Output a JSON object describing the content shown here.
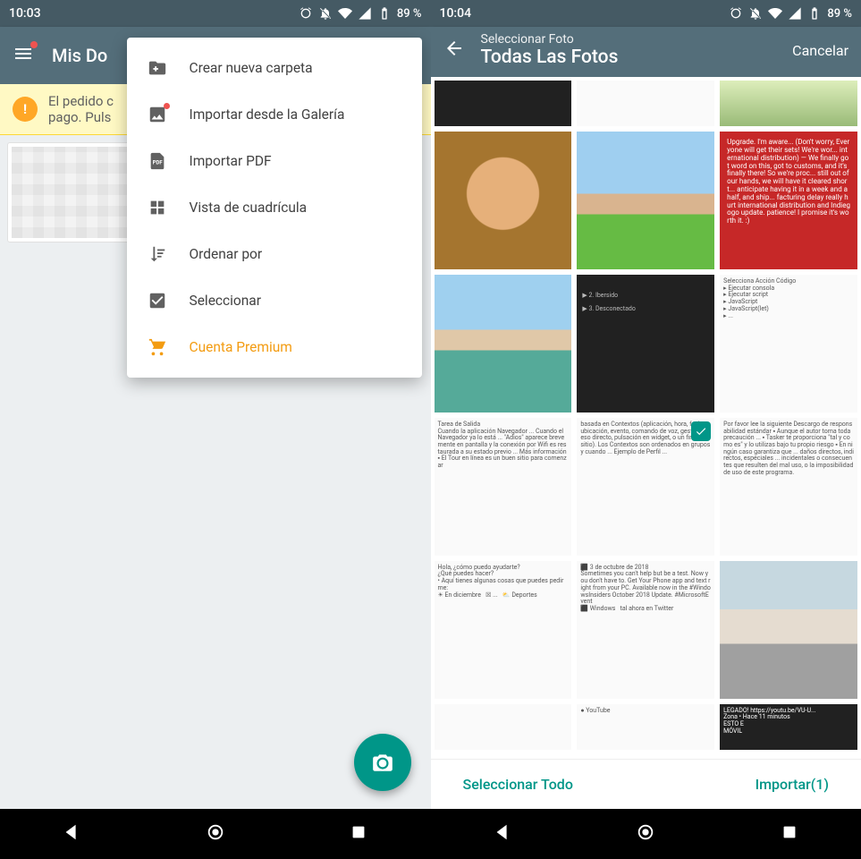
{
  "status": {
    "time_left": "10:03",
    "time_right": "10:04",
    "battery": "89 %"
  },
  "left": {
    "title": "Mis Do",
    "warning_line1": "El pedido c",
    "warning_line2": "pago. Puls",
    "menu": [
      {
        "icon": "folder-plus",
        "label": "Crear nueva carpeta",
        "dot": false
      },
      {
        "icon": "gallery",
        "label": "Importar desde la Galería",
        "dot": true
      },
      {
        "icon": "pdf",
        "label": "Importar PDF",
        "dot": false
      },
      {
        "icon": "grid",
        "label": "Vista de cuadrícula",
        "dot": false
      },
      {
        "icon": "sort",
        "label": "Ordenar por",
        "dot": false
      },
      {
        "icon": "check",
        "label": "Seleccionar",
        "dot": false
      },
      {
        "icon": "cart",
        "label": "Cuenta Premium",
        "dot": false,
        "premium": true
      }
    ]
  },
  "right": {
    "supertitle": "Seleccionar Foto",
    "title": "Todas Las Fotos",
    "cancel": "Cancelar",
    "select_all": "Seleccionar Todo",
    "import": "Importar(1)"
  }
}
